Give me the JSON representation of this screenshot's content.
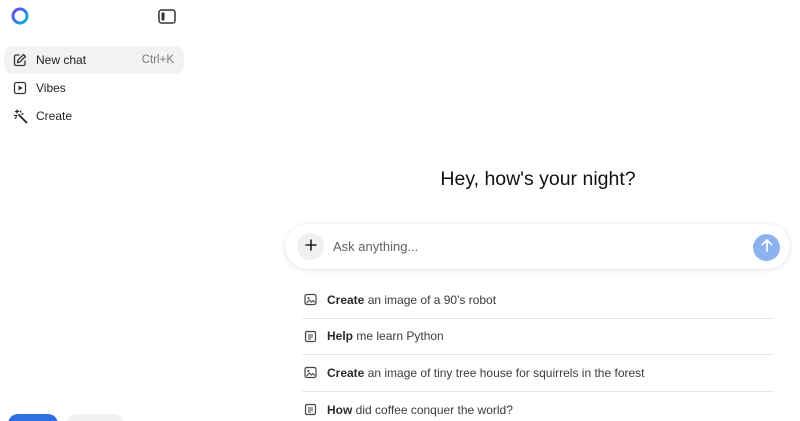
{
  "brand": {
    "logo_icon": "copilot-ring-logo",
    "accent": "#2f6fe4"
  },
  "sidebar": {
    "toggle_icon": "sidebar-toggle-icon",
    "items": [
      {
        "label": "New chat",
        "shortcut": "Ctrl+K",
        "icon": "edit-icon",
        "active": true
      },
      {
        "label": "Vibes",
        "icon": "play-square-icon",
        "active": false
      },
      {
        "label": "Create",
        "icon": "magic-wand-icon",
        "active": false
      }
    ]
  },
  "main": {
    "greeting": "Hey, how's your night?",
    "composer": {
      "placeholder": "Ask anything...",
      "value": "",
      "add_icon": "plus-icon",
      "send_icon": "arrow-up-icon",
      "send_color": "#8cb2ef"
    },
    "suggestions": [
      {
        "bold": "Create",
        "rest": " an image of a 90's robot",
        "icon": "image-icon"
      },
      {
        "bold": "Help",
        "rest": " me learn Python",
        "icon": "document-icon"
      },
      {
        "bold": "Create",
        "rest": " an image of tiny tree house for squirrels in the forest",
        "icon": "image-icon"
      },
      {
        "bold": "How",
        "rest": " did coffee conquer the world?",
        "icon": "document-icon"
      }
    ]
  }
}
